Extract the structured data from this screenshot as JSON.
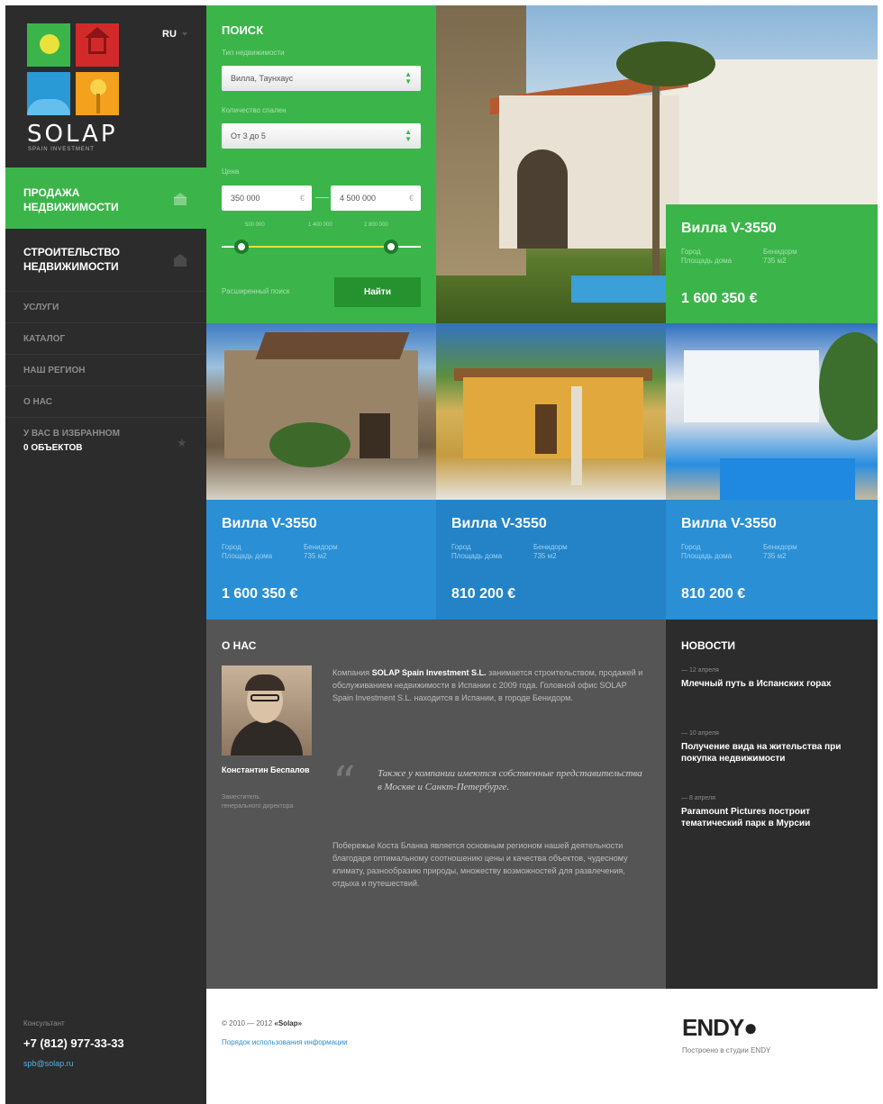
{
  "lang": "RU",
  "logo": {
    "text": "SOLAP",
    "sub": "SPAIN INVESTMENT"
  },
  "nav": {
    "active": "ПРОДАЖА НЕДВИЖИМОСТИ",
    "build": "СТРОИТЕЛЬСТВО НЕДВИЖИМОСТИ",
    "items": [
      "УСЛУГИ",
      "КАТАЛОГ",
      "НАШ РЕГИОН",
      "О НАС"
    ],
    "favorites_label": "У ВАС В ИЗБРАННОМ",
    "favorites_count": "0 ОБЪЕКТОВ"
  },
  "search": {
    "title": "ПОИСК",
    "type_label": "Тип недвижимости",
    "type_value": "Вилла, Таунхаус",
    "rooms_label": "Количество спален",
    "rooms_value": "От 3 до 5",
    "price_label": "Цена",
    "price_from": "350 000",
    "price_to": "4 500 000",
    "currency": "€",
    "ticks": [
      "500 000",
      "1 400 000",
      "2 800 000"
    ],
    "slider_from": 0.1,
    "slider_to": 0.85,
    "advanced": "Расширенный поиск",
    "submit": "Найти"
  },
  "meta_labels": {
    "city": "Город",
    "area": "Площадь дома"
  },
  "featured": {
    "name": "Вилла V-3550",
    "city": "Бенидорм",
    "area": "735 м2",
    "price": "1 600 350 €"
  },
  "listings": [
    {
      "name": "Вилла V-3550",
      "city": "Бенидорм",
      "area": "735 м2",
      "price": "1 600 350 €"
    },
    {
      "name": "Вилла V-3550",
      "city": "Бенидорм",
      "area": "735 м2",
      "price": "810 200 €"
    },
    {
      "name": "Вилла V-3550",
      "city": "Бенидорм",
      "area": "735 м2",
      "price": "810 200 €"
    }
  ],
  "about": {
    "title": "О НАС",
    "person_name": "Константин Беспалов",
    "person_role": "Заместитель генерального директора",
    "p1_pre": "Компания ",
    "p1_company": "SOLAP Spain Investment S.L.",
    "p1_post": " занимается строительством, продажей и обслуживанием недвижимости в Испании с 2009 года. Головной офис SOLAP Spain Investment S.L. находится в Испании, в городе Бенидорм.",
    "quote": "Также у компании имеются собственные представительства в Москве и Санкт-Петербурге.",
    "p2": "Побережье Коста Бланка является основным регионом нашей деятельности благодаря оптимальному соотношению цены и качества объектов, чудесному климату, разнообразию природы, множеству возможностей для развлечения, отдыха и путешествий."
  },
  "news": {
    "title": "НОВОСТИ",
    "items": [
      {
        "date": "— 12 апреля",
        "headline": "Млечный путь в Испанских горах"
      },
      {
        "date": "— 10 апреля",
        "headline": "Получение вида на жительства при покупка недвижимости"
      },
      {
        "date": "— 8 апреля",
        "headline": "Paramount Pictures построит тематический парк в Мурсии"
      }
    ]
  },
  "footer": {
    "consultant_label": "Консультант",
    "phone": "+7 (812) 977-33-33",
    "email": "spb@solap.ru",
    "copyright_pre": "© 2010 — 2012 ",
    "copyright_brand": "«Solap»",
    "policy": "Порядок использования информации",
    "studio_logo": "ENDY",
    "studio_text": "Построено в студии ENDY"
  },
  "icons": {
    "nav_active": "home-icon",
    "nav_build": "home-icon",
    "favorites": "star-icon",
    "select_arrows": "updown-arrow-icon"
  },
  "colors": {
    "green": "#3bb54a",
    "blue": "#2a8fd4",
    "dark": "#2c2c2c",
    "gray": "#555555"
  }
}
